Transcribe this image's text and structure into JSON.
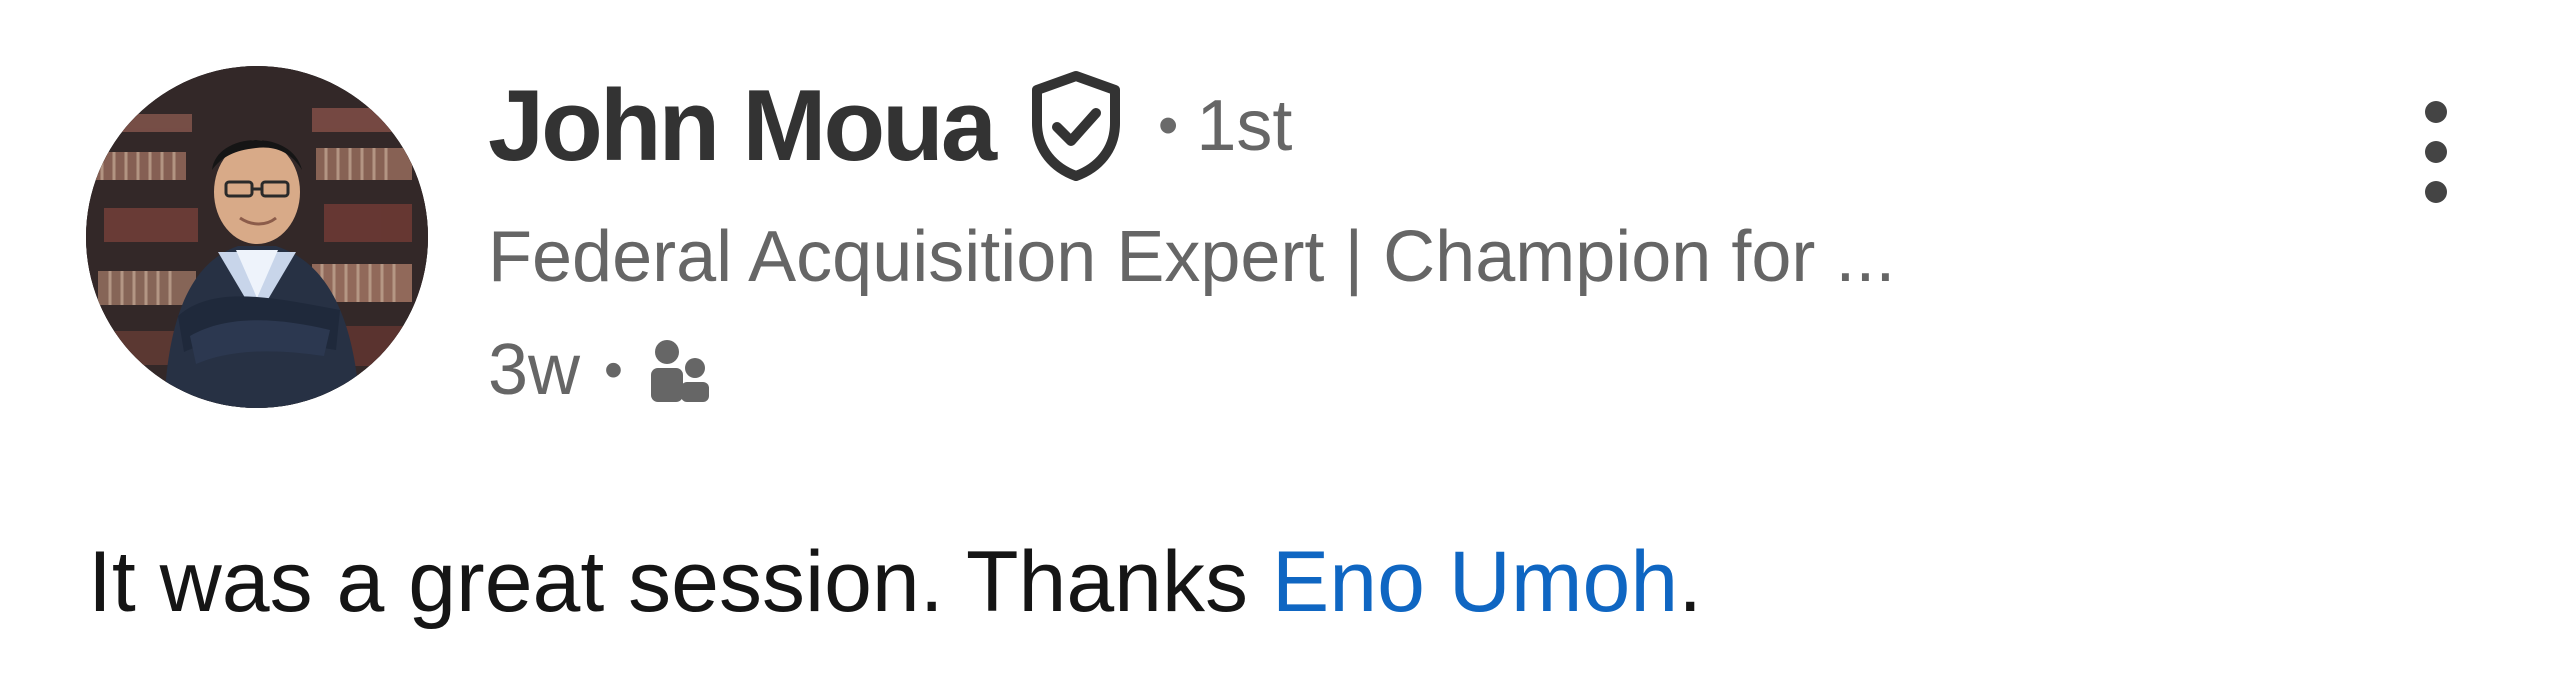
{
  "post": {
    "author": {
      "name": "John Moua",
      "verified_icon": "shield-check-icon",
      "separator": "•",
      "connection_degree": "1st",
      "headline": "Federal Acquisition Expert | Champion for ..."
    },
    "meta": {
      "timestamp": "3w",
      "separator": "•",
      "audience_icon": "connections-icon"
    },
    "text": {
      "before_mention": "It was a great session. Thanks ",
      "mention": "Eno Umoh",
      "after_mention": "."
    },
    "more_icon": "vertical-ellipsis-icon"
  },
  "colors": {
    "name": "#333333",
    "secondary_text": "#666666",
    "body_text": "#151515",
    "mention_link": "#0f66c2",
    "background": "#ffffff"
  }
}
